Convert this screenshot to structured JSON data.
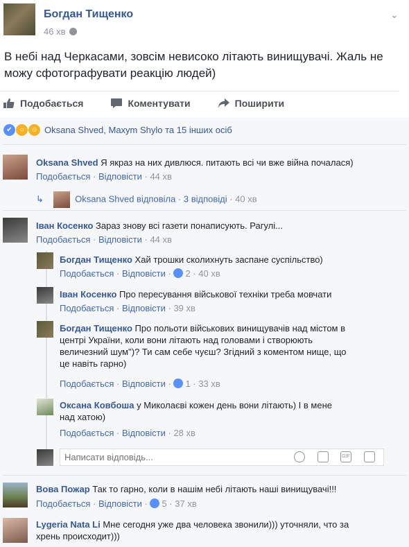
{
  "post": {
    "author": "Богдан Тищенко",
    "time": "46 хв",
    "text": "В небі над Черкасами, зовсім невисоко літають винищувачі. Жаль не можу сфотографувати реакцію людей)"
  },
  "actions": {
    "like": "Подобається",
    "comment": "Коментувати",
    "share": "Поширити"
  },
  "reactions": {
    "summary": "Oksana Shved, Maxym Shylo та 15 інших осіб"
  },
  "comments": [
    {
      "name": "Oksana Shved",
      "text": "Я якраз на них дивлюся. питають всі чи вже війна почалася)",
      "like": "Подобається",
      "reply": "Відповісти",
      "time": "44 хв",
      "replies_summary_name": "Oksana Shved відповіла",
      "replies_summary_count": "3 відповіді",
      "replies_summary_time": "40 хв"
    },
    {
      "name": "Іван Косенко",
      "text": "Зараз знову всі газети понаписують. Рагулі...",
      "like": "Подобається",
      "reply": "Відповісти",
      "time": "44 хв"
    },
    {
      "name": "Вова Пожар",
      "text": "Так то гарно, коли в нашім небі літають наші винищувачі!!!",
      "like": "Подобається",
      "reply": "Відповісти",
      "likes": "5",
      "time": "37 хв"
    },
    {
      "name": "Lygeria Nata Li",
      "text_line1": "Мне сегодня уже два человека звонили))) уточняли, что за",
      "text_line2": "хрень происходит)))"
    }
  ],
  "replies": [
    {
      "name": "Богдан Тищенко",
      "text": "Хай трошки сколихнуть заспане суспільство)",
      "like": "Подобається",
      "reply": "Відповісти",
      "likes": "2",
      "time": "40 хв"
    },
    {
      "name": "Іван Косенко",
      "text": "Про пересування військової техніки треба мовчати",
      "like": "Подобається",
      "reply": "Відповісти",
      "time": "39 хв"
    },
    {
      "name": "Богдан Тищенко",
      "text_line1": "Про польоти військових винищувачів над містом в",
      "text_line2": "центрі України, коли вони літають над головами і створюють",
      "text_line3": "величезний шум\")? Ти сам себе чуєш? Згідний з коментом нище, що",
      "text_line4": "це навіть гарно)",
      "like": "Подобається",
      "reply": "Відповісти",
      "likes": "1",
      "time": "33 хв"
    },
    {
      "name": "Оксана Ковбоша",
      "text_line1": "у Миколаєві кожен день вони літають) І в мене",
      "text_line2": "над хатою)",
      "like": "Подобається",
      "reply": "Відповісти",
      "time": "28 хв"
    }
  ],
  "reply_input": {
    "placeholder": "Написати відповідь..."
  }
}
